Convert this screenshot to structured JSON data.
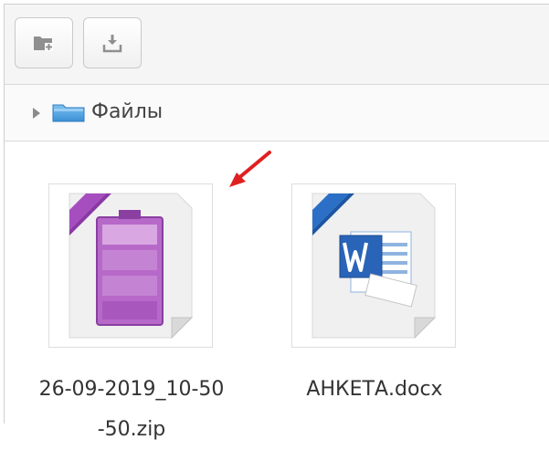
{
  "toolbar": {
    "buttons": [
      {
        "name": "add-folder-icon"
      },
      {
        "name": "download-icon"
      }
    ]
  },
  "breadcrumb": {
    "label": "Файлы",
    "icon": "folder-icon"
  },
  "files": [
    {
      "name": "26-09-2019_10-50-50.zip",
      "type": "archive",
      "icon": "archive-file-icon",
      "ribbon_color": "#b257c8"
    },
    {
      "name": "АНКЕТА.docx",
      "type": "word",
      "icon": "word-file-icon",
      "ribbon_color": "#2b6fc7"
    }
  ],
  "colors": {
    "arrow": "#e02020",
    "toolbar_icon": "#8f8f8f"
  }
}
